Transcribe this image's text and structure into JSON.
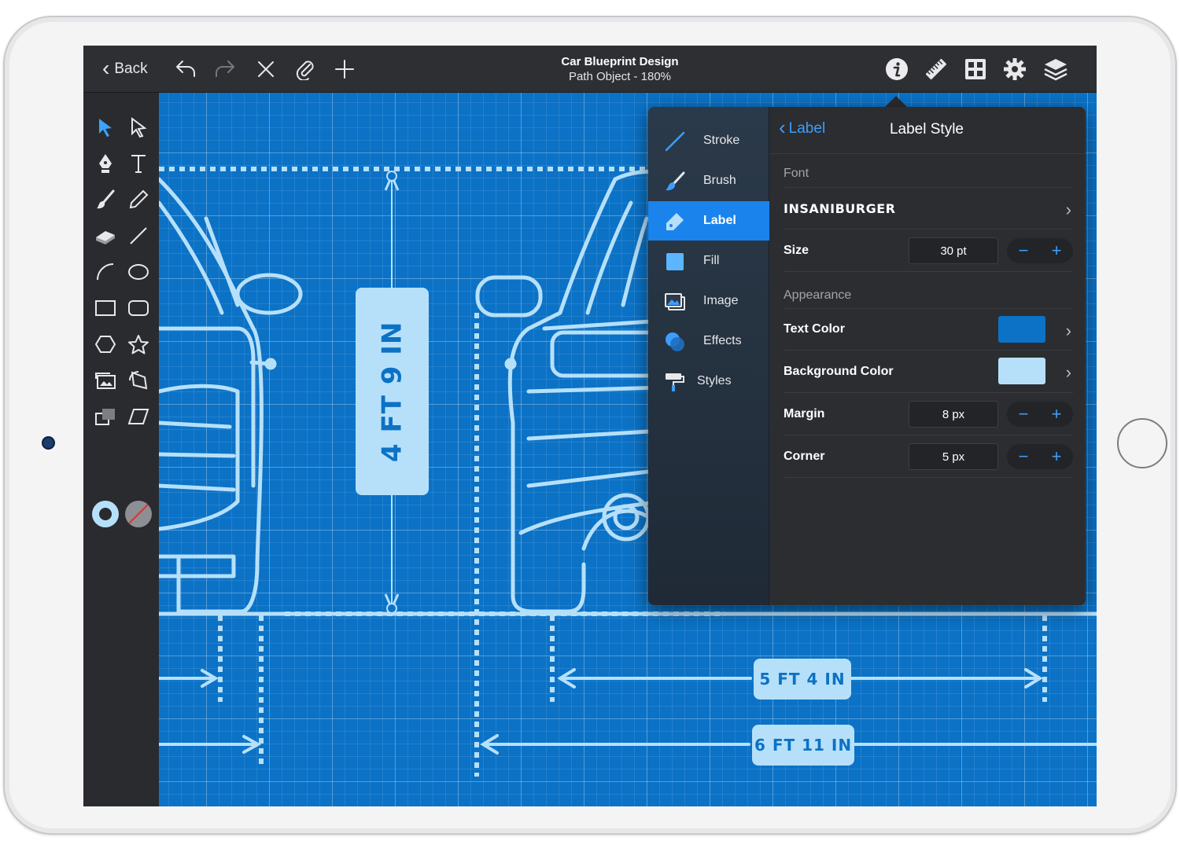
{
  "toolbar": {
    "back_label": "Back",
    "document_title": "Car Blueprint Design",
    "subtitle": "Path Object - 180%",
    "left_icons": [
      "undo-icon",
      "redo-icon",
      "close-icon",
      "paperclip-icon",
      "plus-icon"
    ],
    "right_icons": [
      "info-icon",
      "ruler-icon",
      "grid-icon",
      "gear-icon",
      "layers-icon"
    ]
  },
  "canvas": {
    "dimension_labels": [
      "4 FT 9 IN",
      "5 FT 4 IN",
      "6 FT 11 IN"
    ],
    "colors": {
      "blueprint": "#0b72c6",
      "line": "#b6e0fa"
    }
  },
  "inspector": {
    "sidebar": [
      {
        "label": "Stroke",
        "icon": "stroke-icon",
        "active": false
      },
      {
        "label": "Brush",
        "icon": "brush-icon",
        "active": false
      },
      {
        "label": "Label",
        "icon": "label-icon",
        "active": true
      },
      {
        "label": "Fill",
        "icon": "fill-icon",
        "active": false
      },
      {
        "label": "Image",
        "icon": "image-icon",
        "active": false
      },
      {
        "label": "Effects",
        "icon": "effects-icon",
        "active": false
      },
      {
        "label": "Styles",
        "icon": "styles-icon",
        "active": false
      }
    ],
    "back_label": "Label",
    "title": "Label Style",
    "font_section": "Font",
    "font_name": "INSANIBURGER",
    "size_label": "Size",
    "size_value": "30 pt",
    "appearance_section": "Appearance",
    "text_color_label": "Text Color",
    "text_color": "#0b72c6",
    "background_color_label": "Background Color",
    "background_color": "#b6e0fa",
    "margin_label": "Margin",
    "margin_value": "8 px",
    "corner_label": "Corner",
    "corner_value": "5 px",
    "stepper_minus": "−",
    "stepper_plus": "+",
    "accent": "#1a84ec"
  }
}
